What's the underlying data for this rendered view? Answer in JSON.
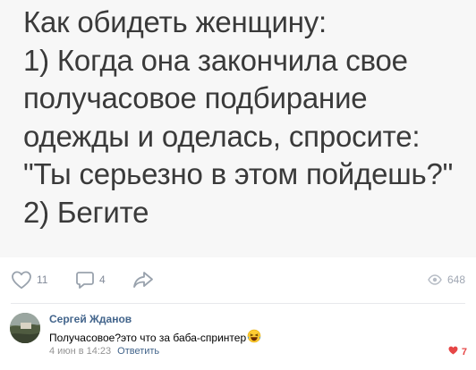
{
  "post": {
    "text": "Как обидеть женщину:\n1) Когда она закончила свое\nполучасовое подбирание\nодежды и оделась, спросите:\n\"Ты серьезно в этом пойдешь?\"\n2) Бегите"
  },
  "actions": {
    "likes": "11",
    "comments": "4",
    "views": "648",
    "icons": [
      "heart-outline-icon",
      "comment-bubble-icon",
      "share-arrow-icon",
      "eye-icon"
    ]
  },
  "comment": {
    "author": "Сергей Жданов",
    "text": "Получасовое?это что за баба-спринтер",
    "emoji": "laughing-tears-emoji",
    "date": "4 июн в 14:23",
    "reply_label": "Ответить",
    "likes": "7"
  },
  "colors": {
    "link": "#42648b",
    "muted": "#828a99",
    "like_active": "#e64646",
    "divider": "#e7e8ec"
  }
}
